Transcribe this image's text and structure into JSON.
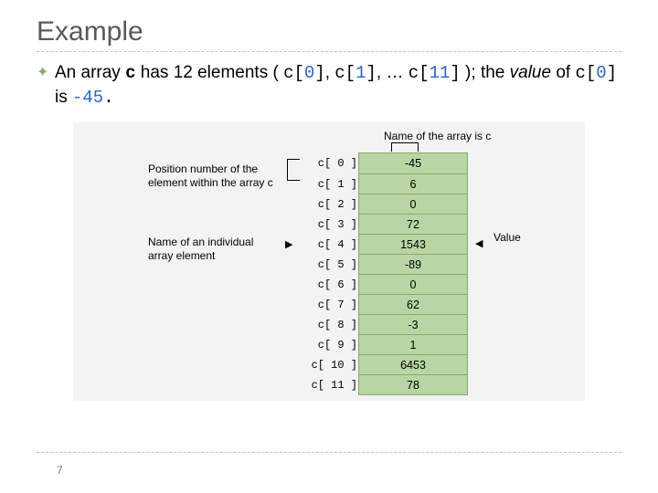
{
  "title": "Example",
  "body": {
    "pre": "An array ",
    "arr_name": "c",
    "mid1": " has 12 elements ( ",
    "ex0_l": "c[",
    "ex0_i": "0",
    "ex0_r": "]",
    "sep1": ", ",
    "ex1_l": "c[",
    "ex1_i": "1",
    "ex1_r": "]",
    "sep2": ", … ",
    "ex11_l": "c[",
    "ex11_i": "11",
    "ex11_r": "]",
    "mid2": " ); the ",
    "value_word": "value",
    "mid3": " of ",
    "val_l": "c[",
    "val_i": "0",
    "val_r": "]",
    "mid4": " is ",
    "neg45": "-45",
    "period": "."
  },
  "annotations": {
    "top": "Name of the array is c",
    "posnum_l1": "Position number of the",
    "posnum_l2": "element within the array c",
    "indiv_l1": "Name of an individual",
    "indiv_l2": "array element",
    "value": "Value"
  },
  "labels": [
    "c[ 0 ]",
    "c[ 1 ]",
    "c[ 2 ]",
    "c[ 3 ]",
    "c[ 4 ]",
    "c[ 5 ]",
    "c[ 6 ]",
    "c[ 7 ]",
    "c[ 8 ]",
    "c[ 9 ]",
    "c[ 10 ]",
    "c[ 11 ]"
  ],
  "values": [
    "-45",
    "6",
    "0",
    "72",
    "1543",
    "-89",
    "0",
    "62",
    "-3",
    "1",
    "6453",
    "78"
  ],
  "page": "7"
}
